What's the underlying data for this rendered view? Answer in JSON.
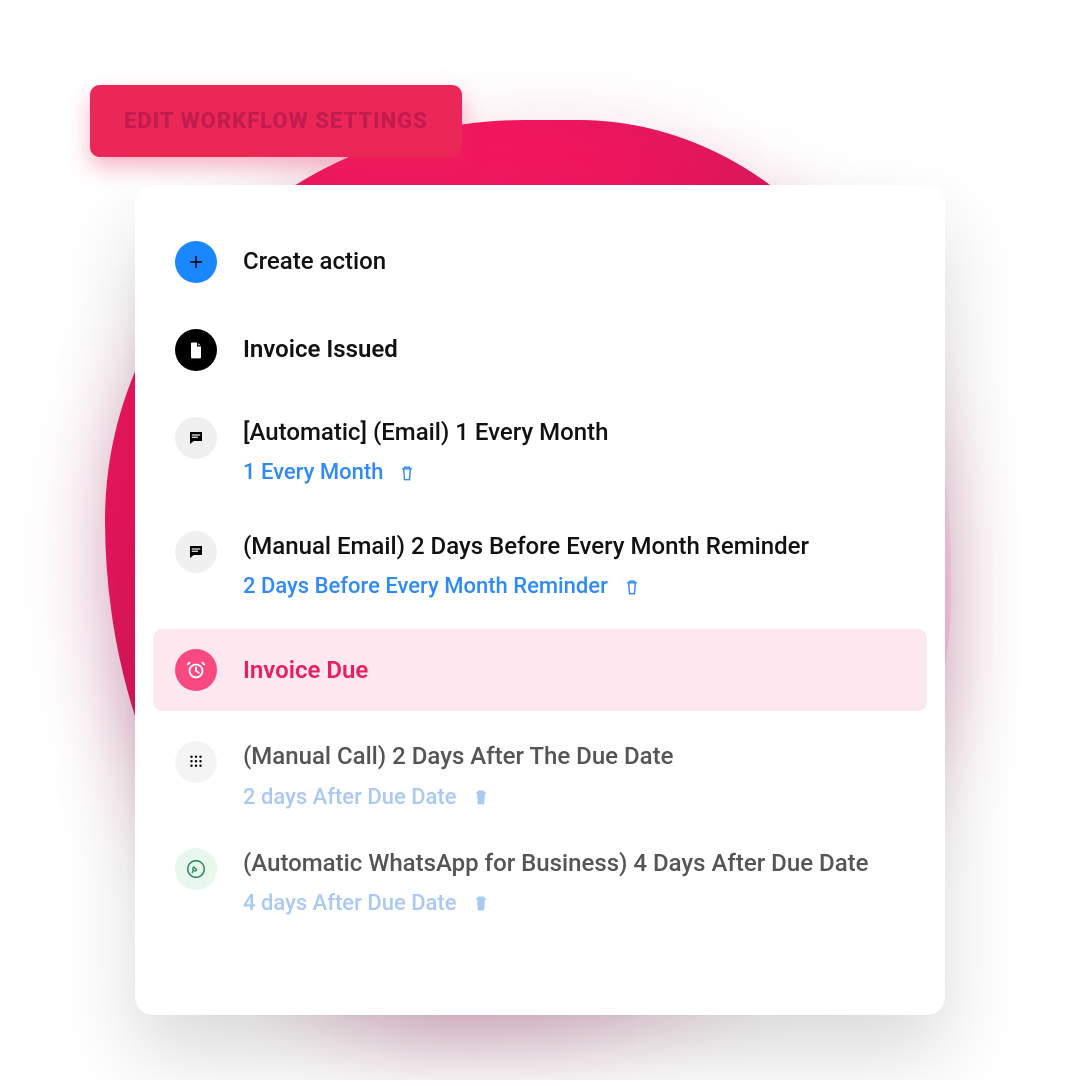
{
  "button": {
    "label": "EDIT WORKFLOW SETTINGS"
  },
  "actions": {
    "create": {
      "title": "Create action"
    },
    "issued": {
      "title": "Invoice Issued"
    },
    "auto_email": {
      "title": "[Automatic] (Email) 1 Every Month",
      "sub": "1 Every Month"
    },
    "manual_email": {
      "title": "(Manual Email) 2 Days Before Every Month Reminder",
      "sub": "2 Days Before Every Month Reminder"
    },
    "due": {
      "title": "Invoice Due"
    },
    "manual_call": {
      "title": "(Manual Call) 2 Days After The Due Date",
      "sub": "2 days After Due Date"
    },
    "whatsapp": {
      "title": "(Automatic WhatsApp for Business) 4 Days After Due Date",
      "sub": "4 days After Due Date"
    }
  }
}
